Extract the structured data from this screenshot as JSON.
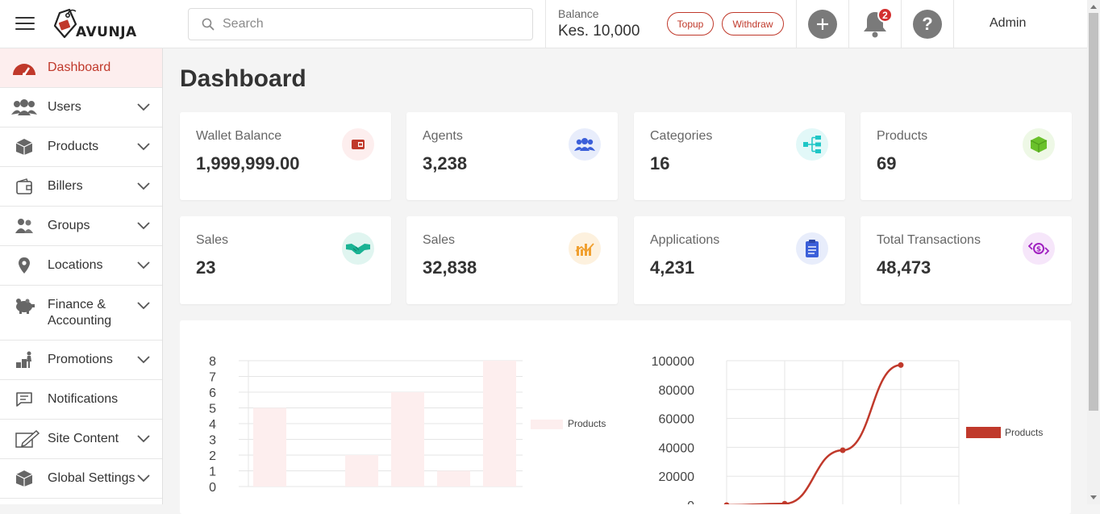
{
  "header": {
    "brand": "AVUNJA",
    "search_placeholder": "Search",
    "balance_label": "Balance",
    "balance_value": "Kes. 10,000",
    "topup_label": "Topup",
    "withdraw_label": "Withdraw",
    "notification_count": "2",
    "user_name": "Admin"
  },
  "sidebar": {
    "items": [
      {
        "label": "Dashboard",
        "icon": "speedometer-icon"
      },
      {
        "label": "Users",
        "icon": "users-icon"
      },
      {
        "label": "Products",
        "icon": "box-icon"
      },
      {
        "label": "Billers",
        "icon": "wallet-icon"
      },
      {
        "label": "Groups",
        "icon": "group-icon"
      },
      {
        "label": "Locations",
        "icon": "map-pin-icon"
      },
      {
        "label": "Finance &\nAccounting",
        "icon": "piggy-bank-icon"
      },
      {
        "label": "Promotions",
        "icon": "promotion-icon"
      },
      {
        "label": "Notifications",
        "icon": "message-icon"
      },
      {
        "label": "Site Content",
        "icon": "edit-icon"
      },
      {
        "label": "Global Settings",
        "icon": "box-icon"
      }
    ]
  },
  "main": {
    "title": "Dashboard",
    "cards": [
      {
        "label": "Wallet Balance",
        "value": "1,999,999.00",
        "icon": "wallet-icon",
        "color": "#c0392b",
        "bg": "#fdeeee"
      },
      {
        "label": "Agents",
        "value": "3,238",
        "icon": "users-icon",
        "color": "#3b5fd9",
        "bg": "#e8edfb"
      },
      {
        "label": "Categories",
        "value": "16",
        "icon": "sitemap-icon",
        "color": "#1fc6c6",
        "bg": "#e2f8f8"
      },
      {
        "label": "Products",
        "value": "69",
        "icon": "cube-icon",
        "color": "#6ac12b",
        "bg": "#eef8e6"
      },
      {
        "label": "Sales",
        "value": "23",
        "icon": "handshake-icon",
        "color": "#1ab394",
        "bg": "#e0f5f0"
      },
      {
        "label": "Sales",
        "value": "32,838",
        "icon": "bar-chart-icon",
        "color": "#f0a030",
        "bg": "#fdf1de"
      },
      {
        "label": "Applications",
        "value": "4,231",
        "icon": "clipboard-icon",
        "color": "#3b5fd9",
        "bg": "#e8edfb"
      },
      {
        "label": "Total Transactions",
        "value": "48,473",
        "icon": "money-exchange-icon",
        "color": "#a020c0",
        "bg": "#f6e6fa"
      }
    ]
  },
  "chart_data": [
    {
      "type": "bar",
      "categories": [
        "",
        "",
        "",
        "",
        "",
        ""
      ],
      "values": [
        5,
        0,
        2,
        6,
        1,
        8
      ],
      "ylim": [
        0,
        8
      ],
      "yticks": [
        "8",
        "7",
        "6",
        "5",
        "4",
        "3",
        "2",
        "1",
        "0"
      ],
      "series": [
        {
          "name": "Products",
          "values": [
            5,
            0,
            2,
            6,
            1,
            8
          ]
        }
      ],
      "legend": "right",
      "color": "#fdeeee",
      "grid": true
    },
    {
      "type": "line",
      "x": [
        0,
        1,
        2,
        3
      ],
      "values": [
        0,
        1000,
        38000,
        97000
      ],
      "ylim": [
        0,
        100000
      ],
      "yticks": [
        "100000",
        "80000",
        "60000",
        "40000",
        "20000",
        "0"
      ],
      "series": [
        {
          "name": "Products",
          "values": [
            0,
            1000,
            38000,
            97000
          ]
        }
      ],
      "legend": "right",
      "color": "#c0392b",
      "grid": true
    }
  ]
}
